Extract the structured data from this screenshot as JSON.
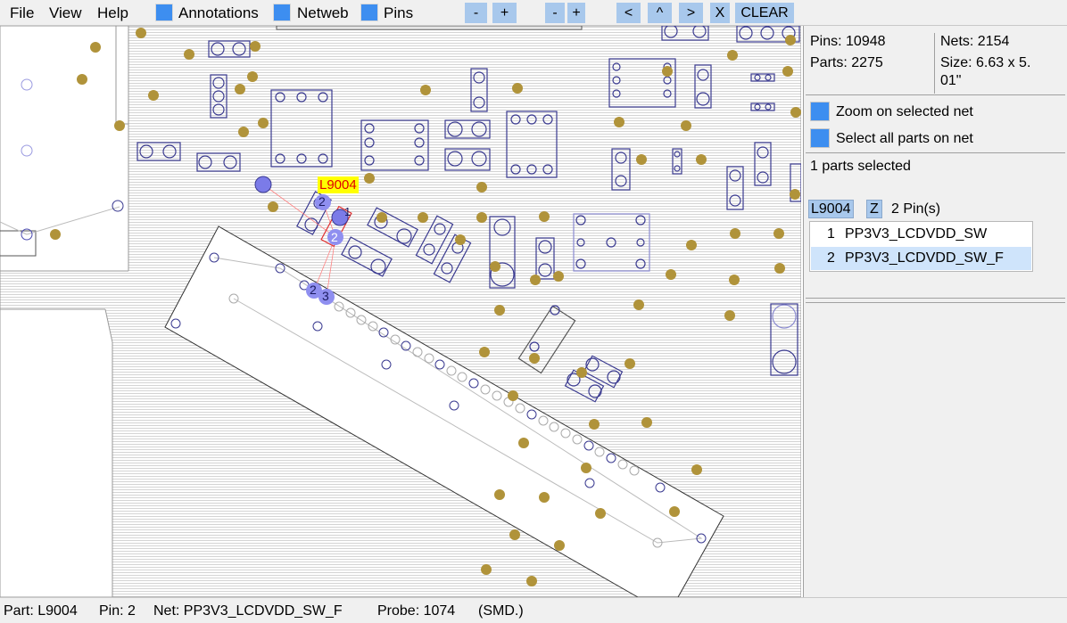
{
  "menu": {
    "file": "File",
    "view": "View",
    "help": "Help"
  },
  "toolbar": {
    "annotations_label": "Annotations",
    "netweb_label": "Netweb",
    "pins_label": "Pins",
    "zoom_out_1": "-",
    "zoom_in_1": "+",
    "zoom_out_2": "-",
    "zoom_in_2": "+",
    "nav_left": "<",
    "nav_up": "^",
    "nav_right": ">",
    "close": "X",
    "clear": "CLEAR"
  },
  "colors": {
    "accent_checkbox": "#3d8ef0",
    "button_bg": "#a8c8ec",
    "via_fill": "#b0933a",
    "pad_stroke": "#3a3a90",
    "selected_part": "#e03030",
    "label_bg": "#ffff00",
    "label_text": "#e00000",
    "highlight_pin": "#7b7be8"
  },
  "board": {
    "selected_part_label": "L9004",
    "pin_labels": [
      "2",
      "1",
      "2",
      "2",
      "3"
    ]
  },
  "stats": {
    "pins": "Pins: 10948",
    "parts": "Parts: 2275",
    "nets": "Nets: 2154",
    "size_line1": "Size: 6.63 x 5.",
    "size_line2": "01\""
  },
  "options": {
    "zoom_selected_net": "Zoom on selected net",
    "select_all_parts": "Select all parts on net"
  },
  "selection": {
    "parts_selected": "1 parts selected",
    "part_name": "L9004",
    "z_button": "Z",
    "pin_count": "2 Pin(s)"
  },
  "nets": [
    {
      "num": "1",
      "name": "PP3V3_LCDVDD_SW"
    },
    {
      "num": "2",
      "name": "PP3V3_LCDVDD_SW_F"
    }
  ],
  "status": {
    "part": "Part: L9004",
    "pin": "Pin: 2",
    "net": "Net: PP3V3_LCDVDD_SW_F",
    "probe": "Probe: 1074",
    "type": "(SMD.)"
  }
}
